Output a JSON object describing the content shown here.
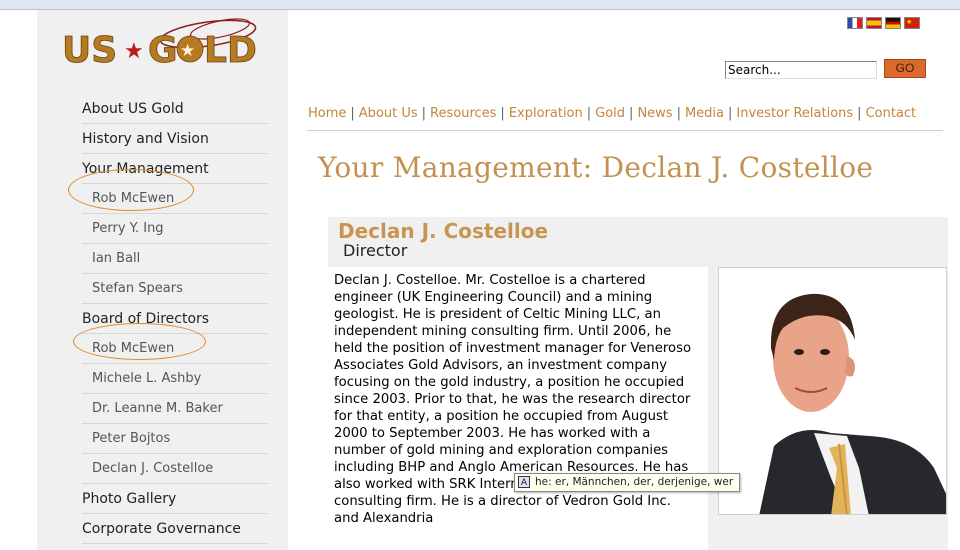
{
  "logo": {
    "text": "US★GOLD"
  },
  "sidebar": {
    "items": [
      {
        "label": "About US Gold",
        "level": "main"
      },
      {
        "label": "History and Vision",
        "level": "main"
      },
      {
        "label": "Your Management",
        "level": "main"
      },
      {
        "label": "Rob McEwen",
        "level": "sub"
      },
      {
        "label": "Perry Y. Ing",
        "level": "sub"
      },
      {
        "label": "Ian Ball",
        "level": "sub"
      },
      {
        "label": "Stefan Spears",
        "level": "sub"
      },
      {
        "label": "Board of Directors",
        "level": "main"
      },
      {
        "label": "Rob McEwen",
        "level": "sub"
      },
      {
        "label": "Michele L. Ashby",
        "level": "sub"
      },
      {
        "label": "Dr. Leanne M. Baker",
        "level": "sub"
      },
      {
        "label": "Peter Bojtos",
        "level": "sub"
      },
      {
        "label": "Declan J. Costelloe",
        "level": "sub"
      },
      {
        "label": "Photo Gallery",
        "level": "main"
      },
      {
        "label": "Corporate Governance",
        "level": "main"
      }
    ]
  },
  "languages": [
    "fr-flag-icon",
    "es-flag-icon",
    "de-flag-icon",
    "cn-flag-icon"
  ],
  "search": {
    "value": "Search...",
    "button_label": "GO"
  },
  "topnav": [
    "Home",
    "About Us",
    "Resources",
    "Exploration",
    "Gold",
    "News",
    "Media",
    "Investor Relations",
    "Contact"
  ],
  "page": {
    "title": "Your Management: Declan J. Costelloe",
    "person_name": "Declan J. Costelloe",
    "person_role": "Director",
    "bio": "Declan J. Costelloe. Mr. Costelloe is a chartered engineer (UK Engineering Council) and a mining geologist. He is president of Celtic Mining LLC, an independent mining consulting firm. Until 2006, he held the position of investment manager for Veneroso Associates Gold Advisors, an investment company focusing on the gold industry, a position he occupied since 2003. Prior to that, he was the research director for that entity, a position he occupied from August 2000 to September 2003. He has worked with a number of gold mining and exploration companies including BHP and Anglo American Resources. He has also worked with SRK International, a mining consulting firm. He is a director of Vedron Gold Inc. and Alexandria"
  },
  "tooltip": {
    "text": "he: er, Männchen, der, derjenige, wer"
  },
  "colors": {
    "accent": "#c4853a",
    "title": "#c4914f",
    "go_button": "#d96a2b",
    "highlight_circle": "#e0892c",
    "sidebar_bg": "#f0f0f0"
  }
}
